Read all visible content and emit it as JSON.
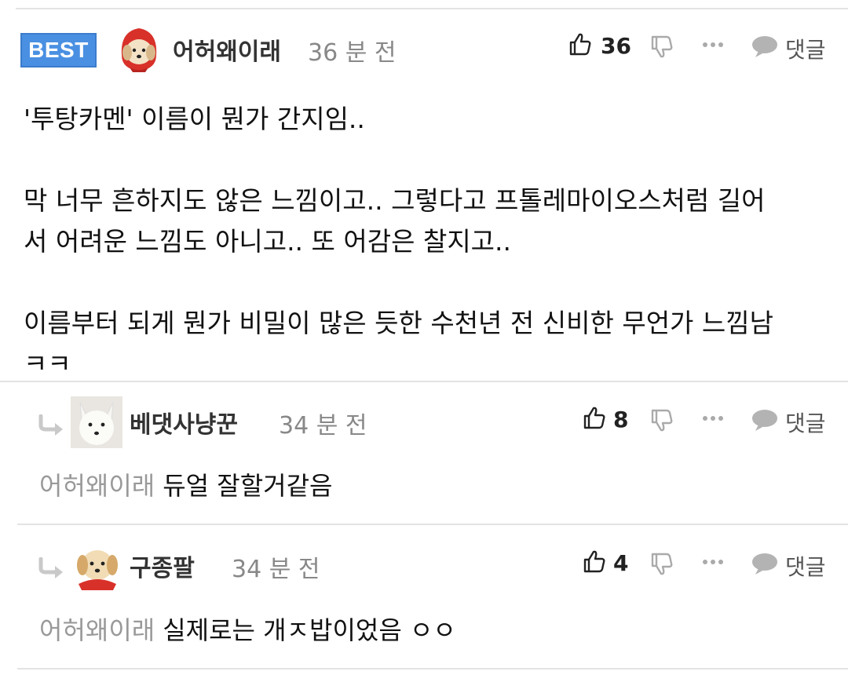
{
  "best_comment": {
    "badge": "BEST",
    "author": "어허왜이래",
    "time": "36 분 전",
    "likes": "36",
    "reply_label": "댓글",
    "lines": [
      "'투탕카멘' 이름이 뭔가 간지임..",
      "",
      "막 너무 흔하지도 않은 느낌이고.. 그렇다고 프톨레마이오스처럼 길어",
      "서 어려운 느낌도 아니고.. 또 어감은 찰지고..",
      "",
      "이름부터 되게 뭔가 비밀이 많은 듯한 수천년 전 신비한 무언가 느낌남",
      "ㅋㅋ"
    ]
  },
  "replies": [
    {
      "author": "베댓사냥꾼",
      "time": "34 분 전",
      "likes": "8",
      "reply_label": "댓글",
      "mention": "어허왜이래",
      "text": "듀얼 잘할거같음"
    },
    {
      "author": "구종팔",
      "time": "34 분 전",
      "likes": "4",
      "reply_label": "댓글",
      "mention": "어허왜이래",
      "text": "실제로는 개ㅈ밥이었음 ㅇㅇ"
    }
  ],
  "icons": {
    "like": "thumbs-up-icon",
    "dislike": "thumbs-down-icon",
    "more": "more-dots-icon",
    "reply": "chat-bubble-icon",
    "reply_arrow": "reply-arrow-icon"
  },
  "colors": {
    "badge_bg": "#4a90e2",
    "muted_text": "#888888",
    "icon_gray": "#aaaaaa"
  }
}
